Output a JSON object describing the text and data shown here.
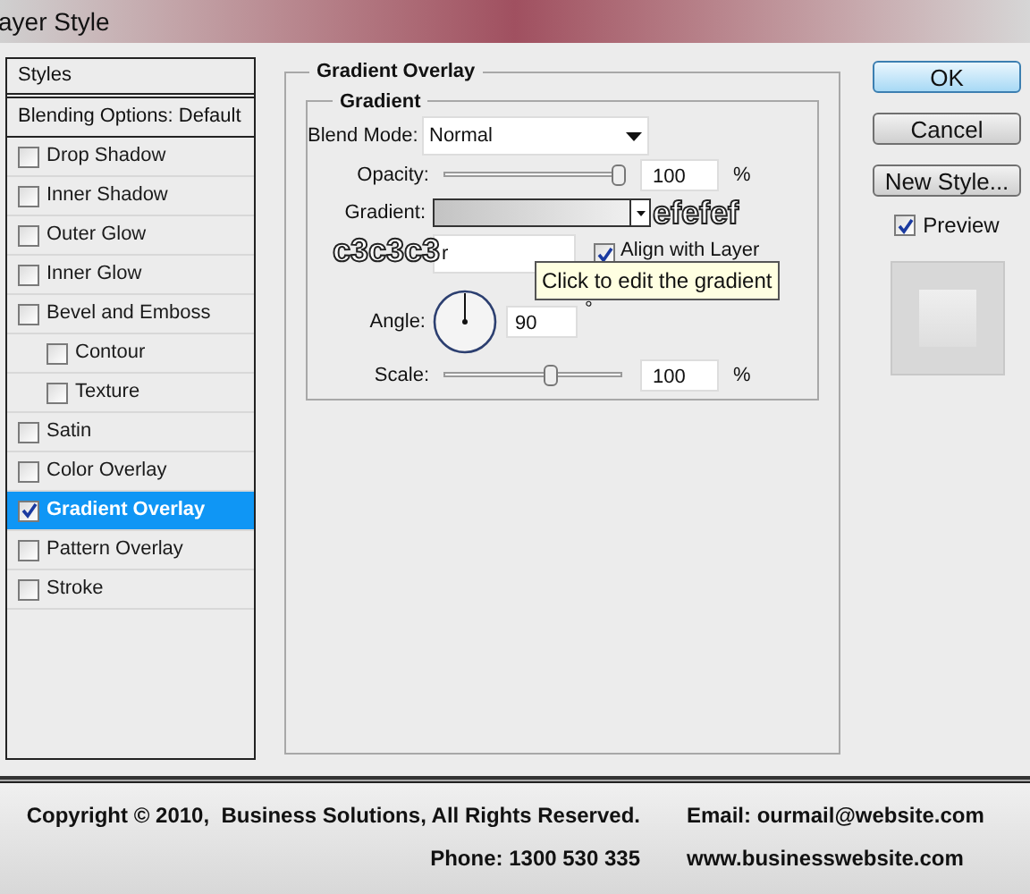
{
  "window": {
    "title": "ayer Style"
  },
  "sidebar": {
    "header": "Styles",
    "blending": "Blending Options: Default",
    "items": [
      {
        "label": "Drop Shadow",
        "checked": false,
        "selected": false
      },
      {
        "label": "Inner Shadow",
        "checked": false,
        "selected": false
      },
      {
        "label": "Outer Glow",
        "checked": false,
        "selected": false
      },
      {
        "label": "Inner Glow",
        "checked": false,
        "selected": false
      },
      {
        "label": "Bevel and Emboss",
        "checked": false,
        "selected": false,
        "children": [
          {
            "label": "Contour",
            "checked": false,
            "selected": false
          },
          {
            "label": "Texture",
            "checked": false,
            "selected": false
          }
        ]
      },
      {
        "label": "Satin",
        "checked": false,
        "selected": false
      },
      {
        "label": "Color Overlay",
        "checked": false,
        "selected": false
      },
      {
        "label": "Gradient Overlay",
        "checked": true,
        "selected": true
      },
      {
        "label": "Pattern Overlay",
        "checked": false,
        "selected": false
      },
      {
        "label": "Stroke",
        "checked": false,
        "selected": false
      }
    ]
  },
  "panel": {
    "title": "Gradient Overlay",
    "group": "Gradient",
    "blend_mode": {
      "label": "Blend Mode:",
      "value": "Normal"
    },
    "opacity": {
      "label": "Opacity:",
      "level": 1,
      "value": "100",
      "unit": "%"
    },
    "gradient": {
      "label": "Gradient:"
    },
    "style": {
      "value": "r"
    },
    "align": {
      "label": "Align with Layer",
      "checked": true
    },
    "tooltip": "Click to edit the gradient",
    "angle": {
      "label": "Angle:",
      "value": "90",
      "unit": "°"
    },
    "scale": {
      "label": "Scale:",
      "level": 0.6,
      "value": "100",
      "unit": "%"
    }
  },
  "annotations": {
    "end_color": "efefef",
    "start_color": "c3c3c3"
  },
  "buttons": [
    {
      "label": "OK",
      "kind": "primary"
    },
    {
      "label": "Cancel",
      "kind": "normal"
    },
    {
      "label": "New Style...",
      "kind": "normal"
    }
  ],
  "preview": {
    "label": "Preview",
    "checked": true
  },
  "footer": {
    "copyright": "Copyright © 2010,  Business Solutions, All Rights Reserved.",
    "phone": "Phone: 1300 530 335",
    "email": "Email: ourmail@website.com",
    "website": "www.businesswebsite.com"
  }
}
